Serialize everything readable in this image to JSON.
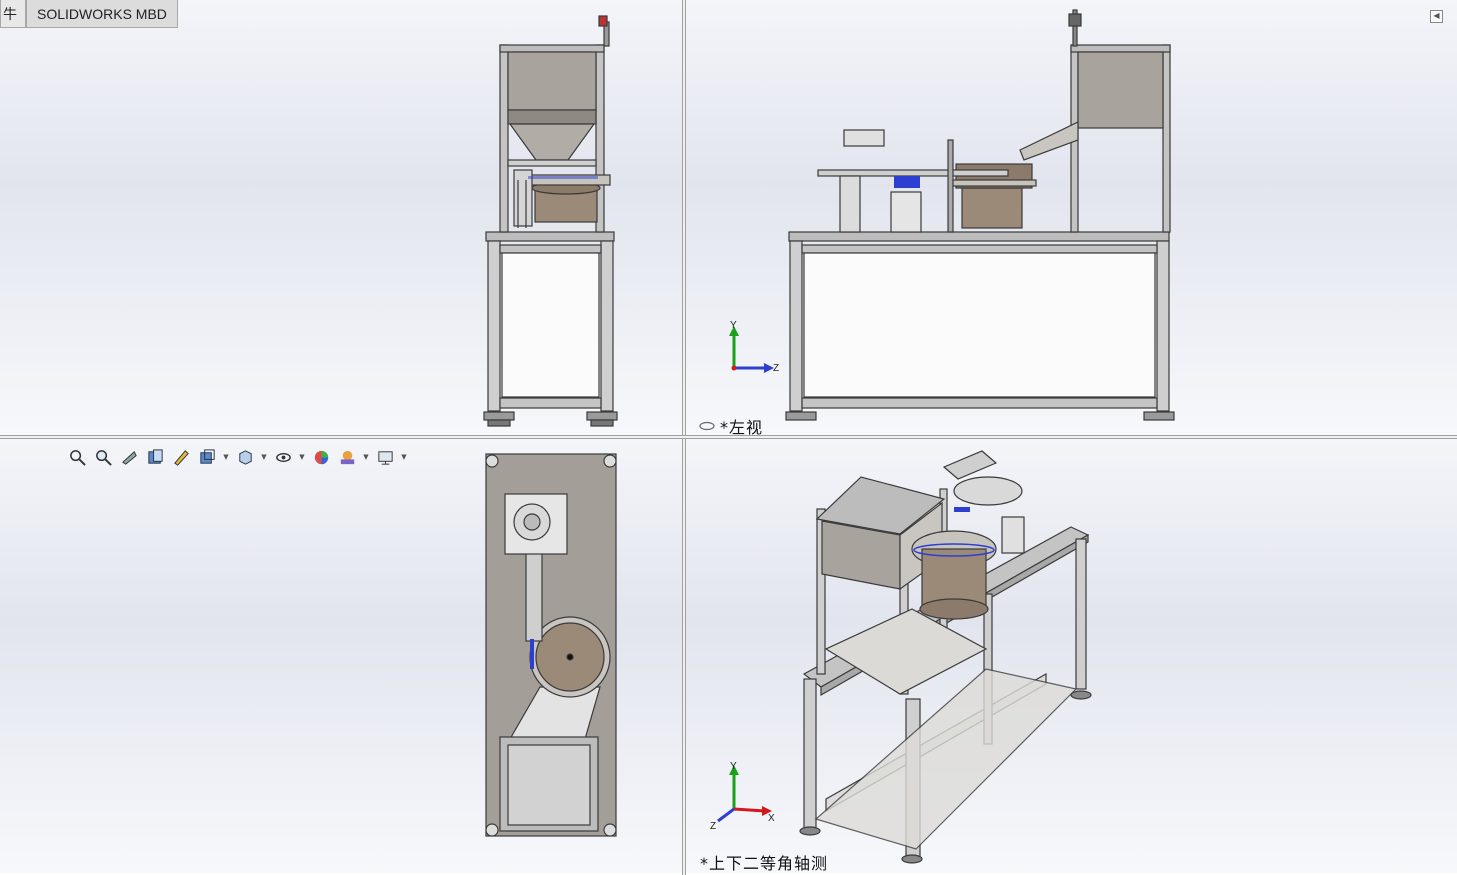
{
  "tabs": [
    {
      "label": "牛"
    },
    {
      "label": "SOLIDWORKS MBD"
    }
  ],
  "views": {
    "left": {
      "label": "*左视"
    },
    "iso": {
      "label": "*上下二等角轴测"
    }
  },
  "triad": {
    "x": "X",
    "y": "Y",
    "z": "Z"
  },
  "toolbar": {
    "icons": [
      "zoom-to-fit-icon",
      "zoom-area-icon",
      "previous-view-icon",
      "section-view-icon",
      "dynamic-annotation-icon",
      "view-orientation-icon",
      "display-style-icon",
      "hide-show-items-icon",
      "edit-appearance-icon",
      "apply-scene-icon",
      "view-settings-icon"
    ]
  },
  "colors": {
    "frame": "#8a8a8a",
    "panel": "#d9d6d2",
    "bowl": "#9b8a78",
    "accent_blue": "#2d3fd0",
    "triad_green": "#1aa01a",
    "triad_red": "#d21818"
  }
}
